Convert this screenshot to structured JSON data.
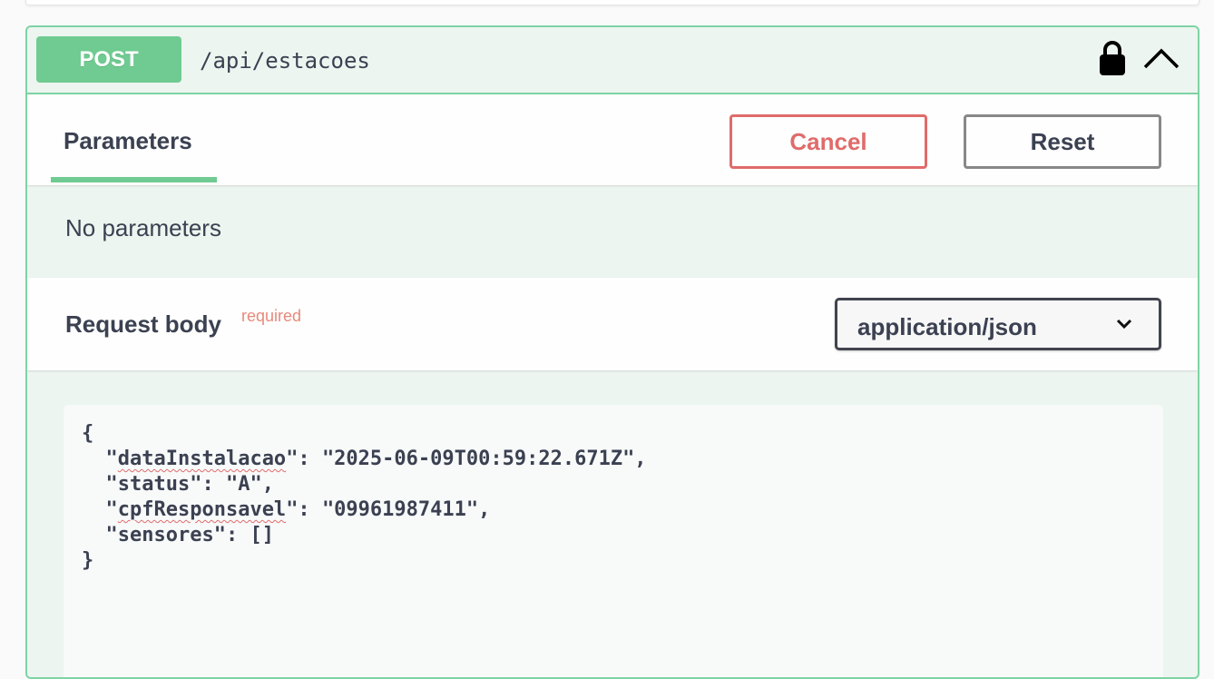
{
  "operation": {
    "method": "POST",
    "path": "/api/estacoes",
    "icons": {
      "lock": "lock-icon",
      "collapse": "chevron-up-icon"
    }
  },
  "tabs": {
    "parameters_label": "Parameters",
    "cancel_label": "Cancel",
    "reset_label": "Reset"
  },
  "parameters": {
    "empty_text": "No parameters"
  },
  "request_body": {
    "title": "Request body",
    "required_label": "required",
    "content_type": "application/json",
    "json": {
      "open_brace": "{",
      "close_brace": "}",
      "lines": [
        {
          "key": "dataInstalacao",
          "value": "\"2025-06-09T00:59:22.671Z\",",
          "squiggle": true
        },
        {
          "key": "status",
          "value": "\"A\",",
          "squiggle": false
        },
        {
          "key": "cpfResponsavel",
          "value": "\"09961987411\",",
          "squiggle": true
        },
        {
          "key": "sensores",
          "value": "[]",
          "squiggle": false
        }
      ]
    }
  },
  "colors": {
    "post_green": "#6fcb91",
    "border_green": "#7ed3a4",
    "cancel_red": "#e06b6b",
    "required_red": "#e9897c",
    "text": "#3b4151"
  }
}
